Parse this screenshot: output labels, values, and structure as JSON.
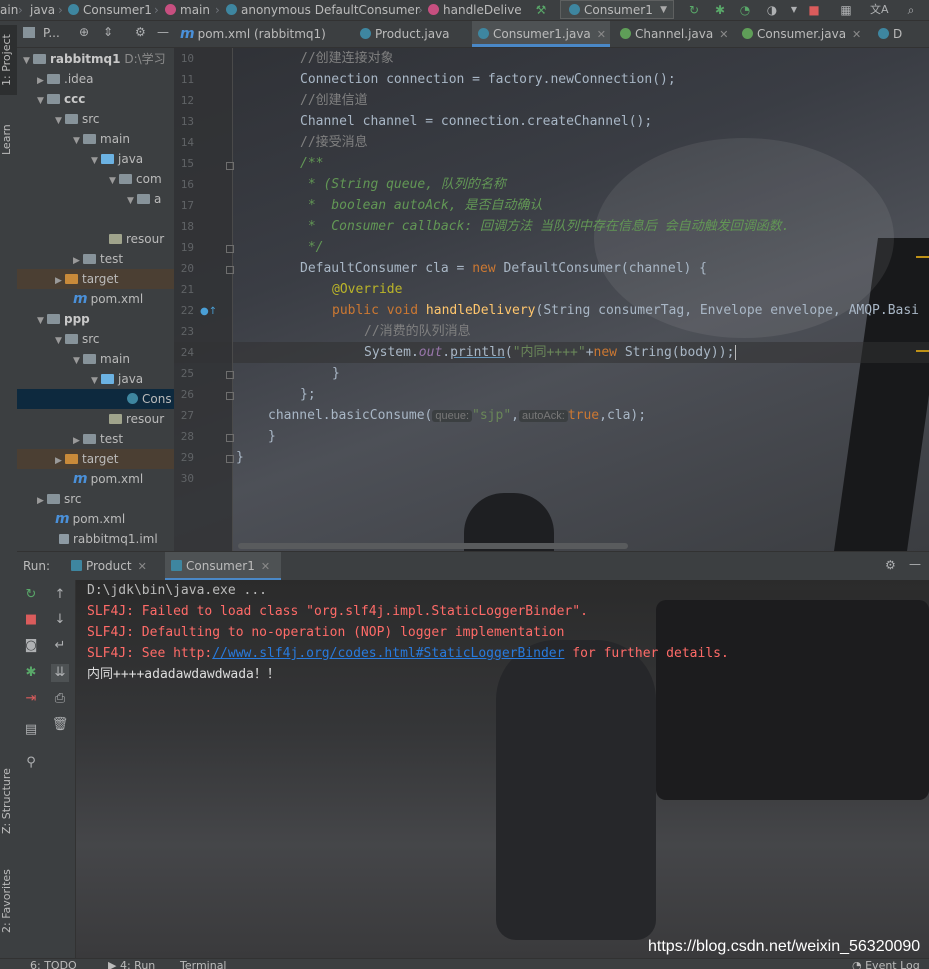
{
  "navbar": {
    "crumbs": [
      "ain",
      "java",
      "Consumer1",
      "main",
      "anonymous DefaultConsumer",
      "handleDelive"
    ],
    "run_config": "Consumer1",
    "translate_icon": "文A"
  },
  "left_stripe": {
    "project": "1: Project",
    "learn": "Learn",
    "structure": "Z: Structure",
    "favorites": "2: Favorites"
  },
  "project_panel": {
    "title": "P...",
    "rows": [
      {
        "label": "rabbitmq1",
        "extra": "D:\\学习"
      },
      {
        "label": ".idea"
      },
      {
        "label": "ccc"
      },
      {
        "label": "src"
      },
      {
        "label": "main"
      },
      {
        "label": "java"
      },
      {
        "label": "com"
      },
      {
        "label": "a"
      },
      {
        "label": ""
      },
      {
        "label": "resour"
      },
      {
        "label": "test"
      },
      {
        "label": "target"
      },
      {
        "label": "pom.xml"
      },
      {
        "label": "ppp"
      },
      {
        "label": "src"
      },
      {
        "label": "main"
      },
      {
        "label": "java"
      },
      {
        "label": "Cons"
      },
      {
        "label": "resour"
      },
      {
        "label": "test"
      },
      {
        "label": "target"
      },
      {
        "label": "pom.xml"
      },
      {
        "label": "src"
      },
      {
        "label": "pom.xml"
      },
      {
        "label": "rabbitmq1.iml"
      }
    ]
  },
  "editor_tabs": [
    {
      "label": "pom.xml (rabbitmq1)"
    },
    {
      "label": "Product.java"
    },
    {
      "label": "Consumer1.java"
    },
    {
      "label": "Channel.java"
    },
    {
      "label": "Consumer.java"
    },
    {
      "label": "D"
    }
  ],
  "code": {
    "line_numbers": [
      "10",
      "11",
      "12",
      "13",
      "14",
      "15",
      "16",
      "17",
      "18",
      "19",
      "20",
      "21",
      "22",
      "23",
      "24",
      "25",
      "26",
      "27",
      "28",
      "29",
      "30"
    ],
    "l10": "//创建连接对象",
    "l11a": "Connection connection = factory.newConnection();",
    "l12": "//创建信道",
    "l13": "Channel channel = connection.createChannel();",
    "l14": "//接受消息",
    "l15": "/**",
    "l16a": " * (String queue, ",
    "l16b": "队列的名称",
    "l17a": " *  boolean autoAck, ",
    "l17b": "是否自动确认",
    "l18a": " *  Consumer callback: ",
    "l18b": "回调方法 当队列中存在信息后 会自动触发回调函数.",
    "l19": " */",
    "l20a": "DefaultConsumer cla = ",
    "l20b": "new",
    "l20c": " DefaultConsumer(channel) {",
    "l21": "@Override",
    "l22a": "public void ",
    "l22b": "handleDelivery",
    "l22c": "(String consumerTag, Envelope envelope, AMQP.Basi",
    "l23": "//消费的队列消息",
    "l24a": "System.",
    "l24b": "out",
    "l24c": ".",
    "l24d": "println",
    "l24e": "(",
    "l24f": "\"内同++++\"",
    "l24g": "+",
    "l24h": "new",
    "l24i": " String(body));",
    "l25": "}",
    "l26": "};",
    "l27a": "channel.basicConsume(",
    "l27h1": "queue:",
    "l27b": "\"sjp\"",
    "l27c": ",",
    "l27h2": "autoAck:",
    "l27d": "true",
    "l27e": ",cla);",
    "l28": "}",
    "l29": "}"
  },
  "run_panel": {
    "label": "Run:",
    "tabs": [
      {
        "label": "Product"
      },
      {
        "label": "Consumer1"
      }
    ],
    "console": {
      "cmd": "D:\\jdk\\bin\\java.exe ...",
      "err1": "SLF4J: Failed to load class \"org.slf4j.impl.StaticLoggerBinder\".",
      "err2": "SLF4J: Defaulting to no-operation (NOP) logger implementation",
      "err3a": "SLF4J: See http:",
      "err3b": "//www.slf4j.org/codes.html#StaticLoggerBinder",
      "err3c": " for further details.",
      "output": "内同++++adadawdawdwada！！"
    }
  },
  "statusbar": {
    "todo": "6: TODO",
    "run": "4: Run",
    "terminal": "Terminal",
    "event_log": "Event Log"
  },
  "watermark": "https://blog.csdn.net/weixin_56320090",
  "colors": {
    "background": "#2b2b2b",
    "panel": "#3c3f41",
    "keyword": "#cc7832",
    "string": "#6a8759",
    "comment": "#808080",
    "error": "#ff6b68",
    "accent": "#4a88c7"
  }
}
